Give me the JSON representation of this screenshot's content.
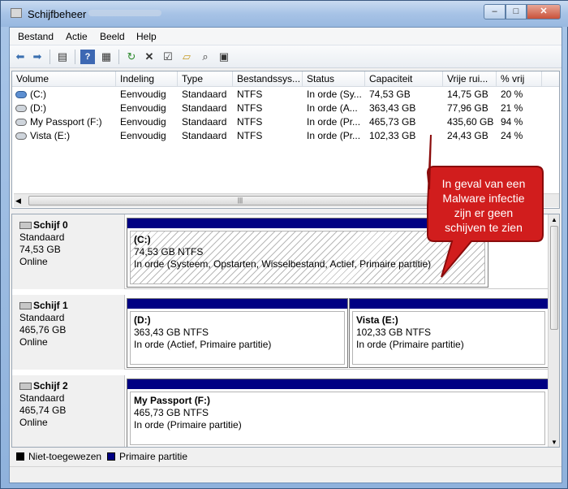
{
  "window": {
    "title": "Schijfbeheer"
  },
  "menu": [
    "Bestand",
    "Actie",
    "Beeld",
    "Help"
  ],
  "toolbar_icons": [
    "back-arrow-icon",
    "forward-arrow-icon",
    "properties-icon",
    "help-icon",
    "show-hide-icon",
    "refresh-icon",
    "delete-icon",
    "properties-page-icon",
    "open-folder-icon",
    "search-icon",
    "rescan-icon"
  ],
  "volume_table": {
    "columns": [
      "Volume",
      "Indeling",
      "Type",
      "Bestandssys...",
      "Status",
      "Capaciteit",
      "Vrije rui...",
      "% vrij"
    ],
    "rows": [
      {
        "volume": "(C:)",
        "indeling": "Eenvoudig",
        "type": "Standaard",
        "fs": "NTFS",
        "status": "In orde (Sy...",
        "capacity": "74,53 GB",
        "free": "14,75 GB",
        "pct": "20 %"
      },
      {
        "volume": "(D:)",
        "indeling": "Eenvoudig",
        "type": "Standaard",
        "fs": "NTFS",
        "status": "In orde (A...",
        "capacity": "363,43 GB",
        "free": "77,96 GB",
        "pct": "21 %"
      },
      {
        "volume": "My Passport (F:)",
        "indeling": "Eenvoudig",
        "type": "Standaard",
        "fs": "NTFS",
        "status": "In orde (Pr...",
        "capacity": "465,73 GB",
        "free": "435,60 GB",
        "pct": "94 %"
      },
      {
        "volume": "Vista (E:)",
        "indeling": "Eenvoudig",
        "type": "Standaard",
        "fs": "NTFS",
        "status": "In orde (Pr...",
        "capacity": "102,33 GB",
        "free": "24,43 GB",
        "pct": "24 %"
      }
    ]
  },
  "disks": [
    {
      "name": "Schijf 0",
      "type": "Standaard",
      "size": "74,53 GB",
      "state": "Online",
      "partitions": [
        {
          "name": "(C:)",
          "size": "74,53 GB NTFS",
          "status": "In orde (Systeem, Opstarten, Wisselbestand, Actief, Primaire partitie)"
        }
      ]
    },
    {
      "name": "Schijf 1",
      "type": "Standaard",
      "size": "465,76 GB",
      "state": "Online",
      "partitions": [
        {
          "name": "(D:)",
          "size": "363,43 GB NTFS",
          "status": "In orde (Actief, Primaire partitie)"
        },
        {
          "name": "Vista  (E:)",
          "size": "102,33 GB NTFS",
          "status": "In orde (Primaire partitie)"
        }
      ]
    },
    {
      "name": "Schijf 2",
      "type": "Standaard",
      "size": "465,74 GB",
      "state": "Online",
      "partitions": [
        {
          "name": "My Passport  (F:)",
          "size": "465,73 GB NTFS",
          "status": "In orde (Primaire partitie)"
        }
      ]
    }
  ],
  "legend": [
    {
      "label": "Niet-toegewezen",
      "color": "#000000"
    },
    {
      "label": "Primaire partitie",
      "color": "#000083"
    }
  ],
  "callout": {
    "lines": [
      "In geval van een",
      "Malware infectie",
      "zijn er geen",
      "schijven te zien"
    ],
    "color": "#d11d1d"
  },
  "colors": {
    "title_bar": "#a7c3e6",
    "primary_partition": "#000083",
    "callout_border": "#b01010"
  }
}
